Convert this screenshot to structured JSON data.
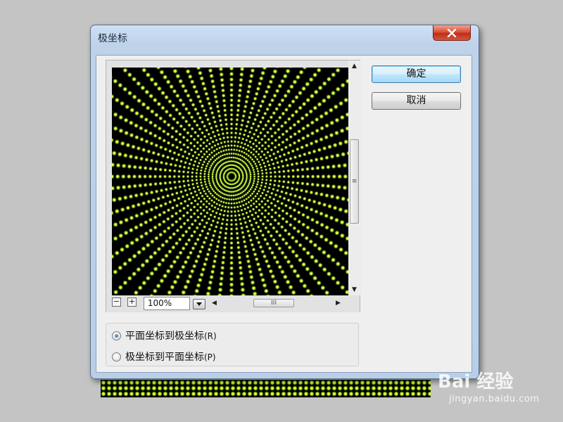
{
  "dialog": {
    "title": "极坐标",
    "close_icon": "close-icon"
  },
  "preview": {
    "zoom_out_label": "−",
    "zoom_in_label": "+",
    "zoom_value": "100%",
    "vscroll_grip": "≡",
    "hscroll_grip": "III"
  },
  "buttons": {
    "ok": "确定",
    "cancel": "取消"
  },
  "options": [
    {
      "label": "平面坐标到极坐标",
      "key": "(R)",
      "checked": true
    },
    {
      "label": "极坐标到平面坐标",
      "key": "(P)",
      "checked": false
    }
  ],
  "watermark": {
    "logo": "Bai 经验",
    "url": "jingyan.baidu.com"
  },
  "colors": {
    "pattern_glow": "#c8ff2a",
    "pattern_bg": "#000000",
    "default_button": "#bee6fd"
  }
}
